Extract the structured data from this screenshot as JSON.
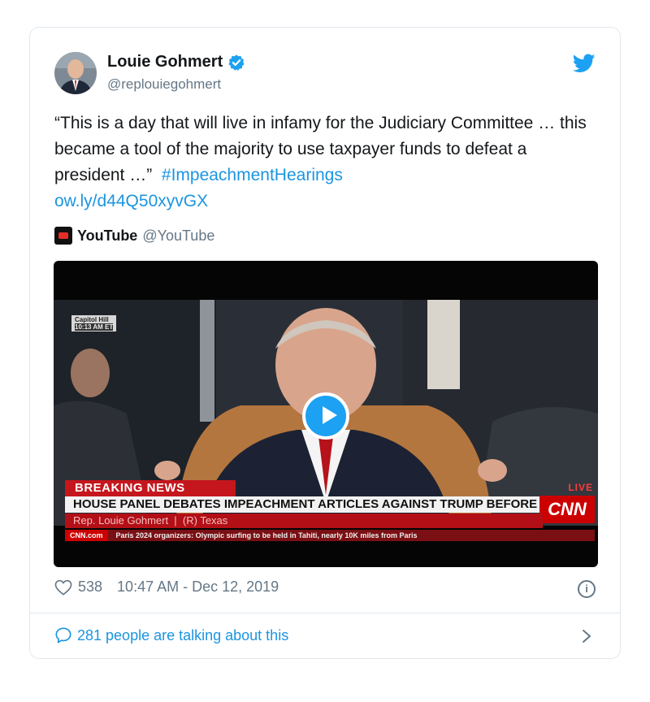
{
  "author": {
    "name": "Louie Gohmert",
    "handle": "@replouiegohmert"
  },
  "tweet": {
    "text": "“This is a day that will live in infamy for the Judiciary Committee … this became a tool of the majority to use taxpayer funds to defeat a president …”",
    "hashtag": "#ImpeachmentHearings",
    "link": "ow.ly/d44Q50xyvGX"
  },
  "source": {
    "name": "YouTube",
    "handle": "@YouTube"
  },
  "video": {
    "location_tag": "Capitol Hill",
    "time_tag": "10:13 AM ET",
    "breaking_label": "BREAKING NEWS",
    "live_label": "LIVE",
    "headline": "HOUSE PANEL DEBATES IMPEACHMENT ARTICLES AGAINST TRUMP BEFORE VOTE",
    "speaker": "Rep. Louie Gohmert",
    "speaker_party": "(R) Texas",
    "network": "CNN",
    "ticker_source": "CNN.com",
    "ticker_text": "Paris 2024 organizers: Olympic surfing to be held in Tahiti, nearly 10K miles from Paris"
  },
  "meta": {
    "likes": "538",
    "timestamp": "10:47 AM - Dec 12, 2019"
  },
  "conversation": {
    "label": "281 people are talking about this"
  },
  "colors": {
    "accent": "#1b95e0",
    "verified": "#1da1f2",
    "secondary_text": "#657786",
    "breaking_red": "#c5161d"
  },
  "icons": [
    "verified-badge-icon",
    "twitter-bird-icon",
    "youtube-logo-icon",
    "play-icon",
    "heart-icon",
    "info-icon",
    "speech-bubble-icon",
    "chevron-right-icon"
  ]
}
